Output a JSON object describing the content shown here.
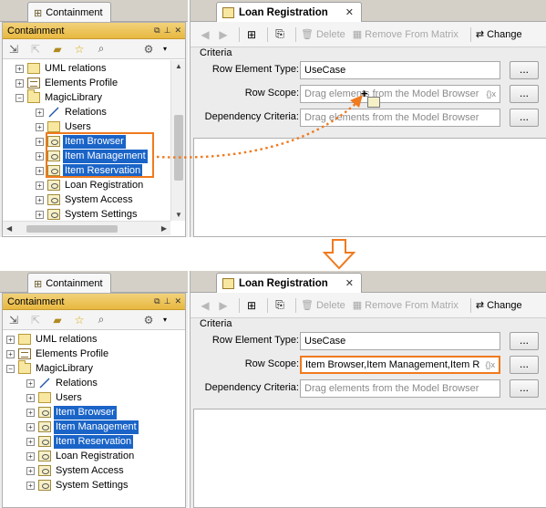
{
  "left_panel": {
    "tab_label": "Containment",
    "header_label": "Containment",
    "tree": [
      {
        "label": "UML relations",
        "icon": "folder",
        "level": 0,
        "expander": "+"
      },
      {
        "label": "Elements Profile",
        "icon": "profile",
        "level": 0,
        "expander": "+"
      },
      {
        "label": "MagicLibrary",
        "icon": "package",
        "level": 0,
        "expander": "-"
      },
      {
        "label": "Relations",
        "icon": "relation",
        "level": 1,
        "expander": "+"
      },
      {
        "label": "Users",
        "icon": "folder",
        "level": 1,
        "expander": "+"
      },
      {
        "label": "Item Browser",
        "icon": "usecase",
        "level": 1,
        "expander": "+",
        "selected": true
      },
      {
        "label": "Item Management",
        "icon": "usecase",
        "level": 1,
        "expander": "+",
        "selected": true
      },
      {
        "label": "Item Reservation",
        "icon": "usecase",
        "level": 1,
        "expander": "+",
        "selected": true
      },
      {
        "label": "Loan Registration",
        "icon": "usecase",
        "level": 1,
        "expander": "+"
      },
      {
        "label": "System Access",
        "icon": "usecase",
        "level": 1,
        "expander": "+"
      },
      {
        "label": "System Settings",
        "icon": "usecase",
        "level": 1,
        "expander": "+"
      }
    ]
  },
  "right_panel": {
    "tab_label": "Loan Registration",
    "toolbar": {
      "delete_label": "Delete",
      "remove_label": "Remove From Matrix",
      "change_label": "Change"
    },
    "criteria": {
      "title": "Criteria",
      "row_element_type_label": "Row Element Type:",
      "row_element_type_value": "UseCase",
      "row_scope_label": "Row Scope:",
      "row_scope_placeholder": "Drag elements from the Model Browser",
      "row_scope_value_after": "Item Browser,Item Management,Item R",
      "dependency_label": "Dependency Criteria:",
      "dependency_placeholder": "Drag elements from the Model Browser",
      "ellipsis": "...",
      "expr_marker": "{}x"
    }
  },
  "colors": {
    "highlight": "#f07a1e",
    "selection": "#1a64c8",
    "panel_header": "#e8b840"
  }
}
